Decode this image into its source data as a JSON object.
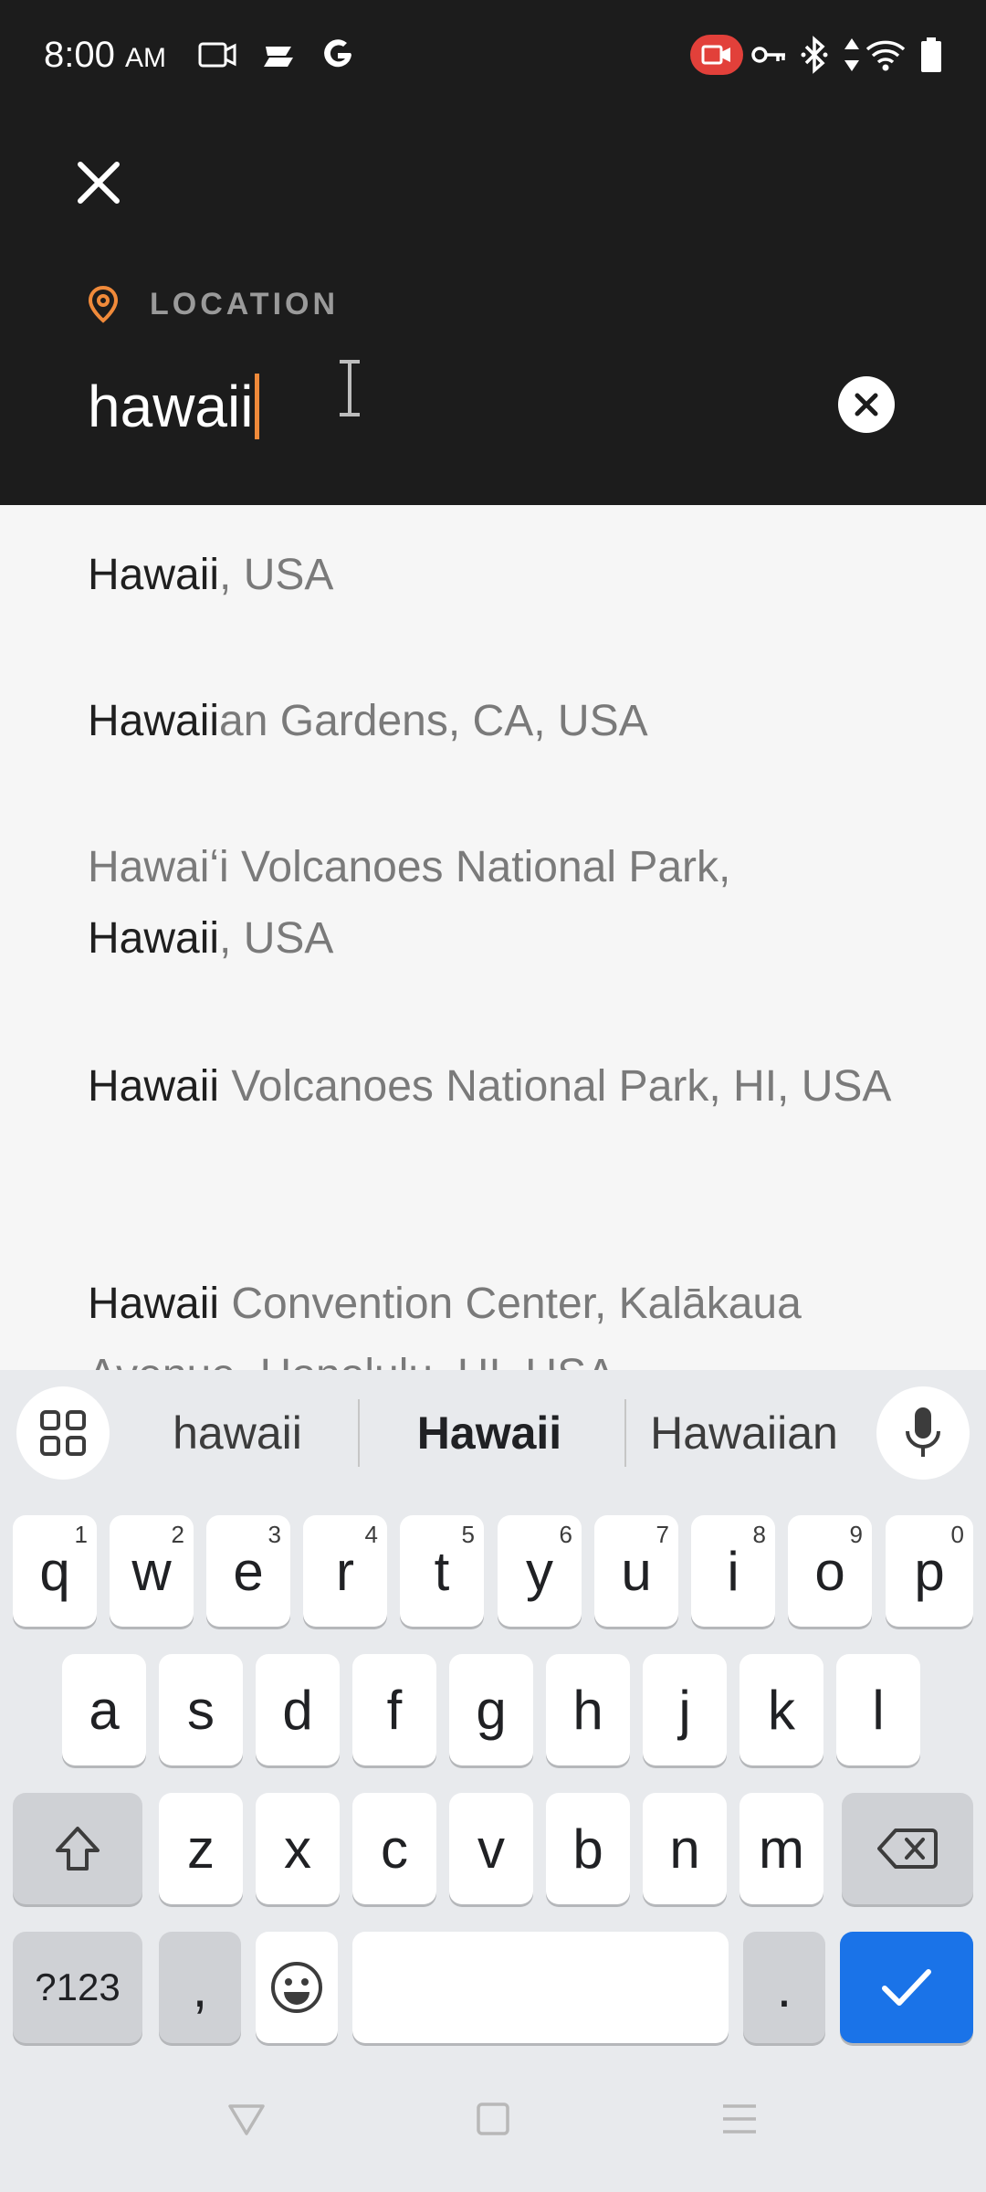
{
  "status_bar": {
    "time": "8:00",
    "ampm": "AM",
    "left_icons": [
      "screen-record-icon",
      "relay-icon",
      "google-icon"
    ],
    "right_icons": [
      "recording-camera-icon",
      "vpn-key-icon",
      "bluetooth-icon",
      "data-arrows-icon",
      "wifi-icon",
      "battery-icon"
    ]
  },
  "header": {
    "close_icon": "close-icon",
    "location_label": "LOCATION",
    "location_icon": "location-pin-icon",
    "search_value": "hawaii",
    "clear_icon": "clear-circle-icon",
    "accent_color": "#f08a3a"
  },
  "results": [
    {
      "match": "Hawaii",
      "rest": ", USA"
    },
    {
      "match": "Hawaii",
      "rest": "an Gardens, CA, USA"
    },
    {
      "prefix": "Hawaiʻi Volcanoes National Park,",
      "match": "Hawaii",
      "rest": ", USA"
    },
    {
      "match": "Hawaii",
      "rest": " Volcanoes National Park, HI, USA"
    },
    {
      "match": "Hawaii",
      "rest": " Convention Center, Kalākaua Avenue, Honolulu, HI, USA"
    }
  ],
  "keyboard": {
    "suggestions": [
      "hawaii",
      "Hawaii",
      "Hawaiian"
    ],
    "row1": [
      {
        "k": "q",
        "h": "1"
      },
      {
        "k": "w",
        "h": "2"
      },
      {
        "k": "e",
        "h": "3"
      },
      {
        "k": "r",
        "h": "4"
      },
      {
        "k": "t",
        "h": "5"
      },
      {
        "k": "y",
        "h": "6"
      },
      {
        "k": "u",
        "h": "7"
      },
      {
        "k": "i",
        "h": "8"
      },
      {
        "k": "o",
        "h": "9"
      },
      {
        "k": "p",
        "h": "0"
      }
    ],
    "row2": [
      "a",
      "s",
      "d",
      "f",
      "g",
      "h",
      "j",
      "k",
      "l"
    ],
    "row3": [
      "z",
      "x",
      "c",
      "v",
      "b",
      "n",
      "m"
    ],
    "symbols_label": "?123",
    "comma": ",",
    "period": ".",
    "enter_color": "#1a73e8"
  }
}
